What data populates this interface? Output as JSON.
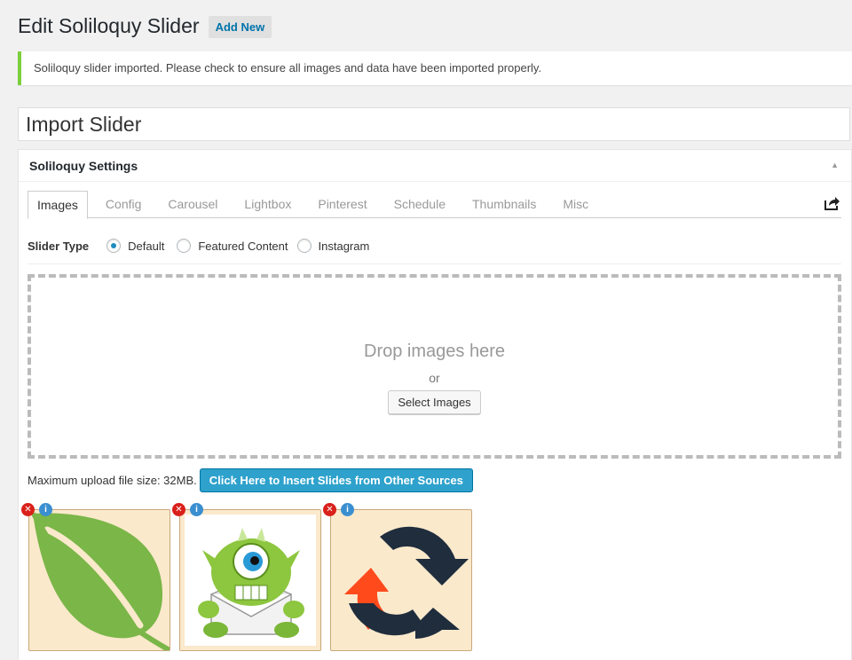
{
  "page": {
    "title": "Edit Soliloquy Slider",
    "add_new": "Add New"
  },
  "notice": {
    "text": "Soliloquy slider imported. Please check to ensure all images and data have been imported properly."
  },
  "slider_title": {
    "value": "Import Slider"
  },
  "settings": {
    "header": "Soliloquy Settings",
    "tabs": [
      {
        "label": "Images",
        "active": true
      },
      {
        "label": "Config",
        "active": false
      },
      {
        "label": "Carousel",
        "active": false
      },
      {
        "label": "Lightbox",
        "active": false
      },
      {
        "label": "Pinterest",
        "active": false
      },
      {
        "label": "Schedule",
        "active": false
      },
      {
        "label": "Thumbnails",
        "active": false
      },
      {
        "label": "Misc",
        "active": false
      }
    ],
    "slider_type": {
      "label": "Slider Type",
      "options": [
        {
          "label": "Default",
          "checked": true
        },
        {
          "label": "Featured Content",
          "checked": false
        },
        {
          "label": "Instagram",
          "checked": false
        }
      ]
    },
    "dropzone": {
      "title": "Drop images here",
      "or": "or",
      "button": "Select Images"
    },
    "upload": {
      "max_size": "Maximum upload file size: 32MB.",
      "insert_button": "Click Here to Insert Slides from Other Sources"
    },
    "slides": [
      {
        "name": "leaf"
      },
      {
        "name": "monster"
      },
      {
        "name": "sync-arrows"
      }
    ]
  },
  "colors": {
    "notice_accent": "#7ad03a",
    "primary_button": "#2ea2cc",
    "link": "#0073aa",
    "thumb_bg": "#fbe9cc",
    "leaf_green": "#7ab648",
    "delete_red": "#d9201a",
    "info_blue": "#3a8fd0"
  }
}
